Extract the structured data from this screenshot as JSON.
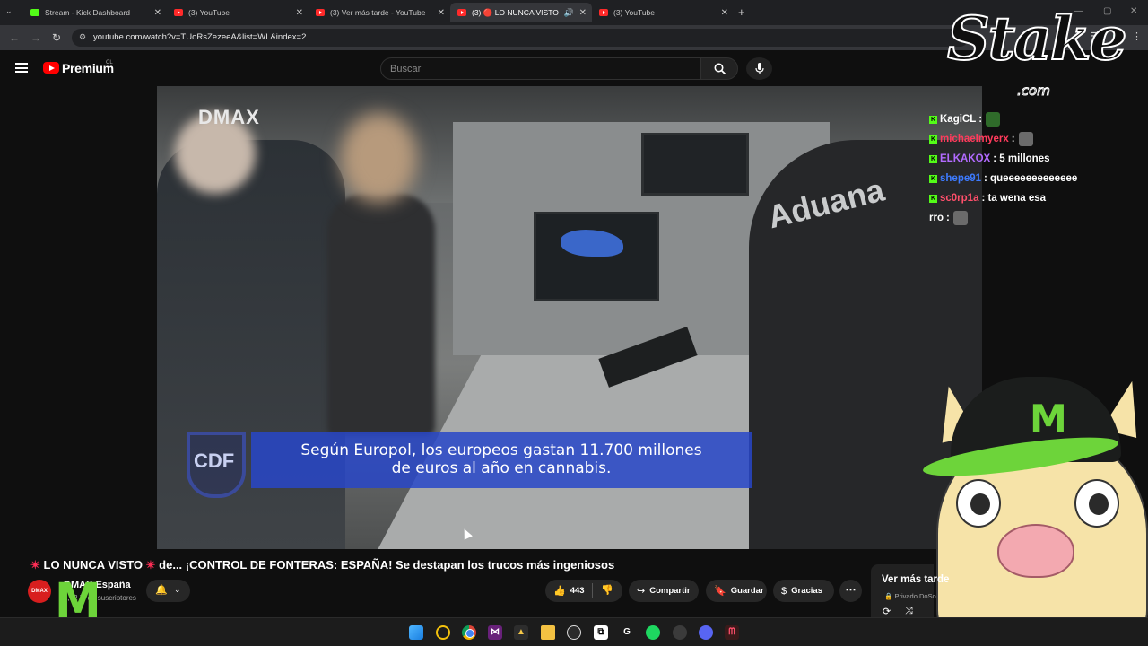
{
  "browser": {
    "tabs": [
      {
        "title": "Stream - Kick Dashboard",
        "icon": "kick-icon"
      },
      {
        "title": "(3) YouTube",
        "icon": "youtube-icon"
      },
      {
        "title": "(3) Ver más tarde - YouTube",
        "icon": "youtube-icon"
      },
      {
        "title": "(3) 🔴 LO NUNCA VISTO 🔴",
        "icon": "youtube-icon",
        "active": true
      },
      {
        "title": "(3) YouTube",
        "icon": "youtube-icon"
      }
    ],
    "url": "youtube.com/watch?v=TUoRsZezeeA&list=WL&index=2"
  },
  "youtube": {
    "brand": "Premium",
    "region": "CL",
    "search_placeholder": "Buscar"
  },
  "video": {
    "channel_watermark": "DMAX",
    "scene_text": "Aduana",
    "show_logo": "CDF",
    "subtitle_line1": "Según Europol, los europeos gastan 11.700 millones",
    "subtitle_line2": "de euros al año en cannabis.",
    "title_prefix": "✴",
    "title_main": " LO NUNCA VISTO ",
    "title_suffix_star": "✴",
    "title_rest": " de... ¡CONTROL DE FONTERAS: ESPAÑA! Se destapan los trucos más ingeniosos",
    "channel_avatar_text": "DMAX",
    "channel_name": "DMAX España",
    "subscribers": "1,32 M de suscriptores",
    "likes": "443",
    "share_label": "Compartir",
    "save_label": "Guardar",
    "thanks_label": "Gracias"
  },
  "playlist": {
    "title": "Ver más tarde",
    "privacy": "Privado",
    "owner": "DoSo"
  },
  "overlay": {
    "stake_word": "Stake",
    "stake_domain": ".com",
    "chat": [
      {
        "user": "KagiCL",
        "user_color": "#ffffff",
        "message": ":",
        "emote": true
      },
      {
        "user": "michaelmyerx",
        "user_color": "#ff3b5c",
        "message": ":",
        "emote": true
      },
      {
        "user": "ELKAKOX",
        "user_color": "#b26bff",
        "message": ": 5 millones",
        "emote": false
      },
      {
        "user": "shepe91",
        "user_color": "#3d7bff",
        "message": ": queeeeeeeeeeeee",
        "emote": false
      },
      {
        "user": "sc0rp1a",
        "user_color": "#ff4f6b",
        "message": ": ta wena esa",
        "emote": false
      },
      {
        "user": "rro",
        "user_color": "#ffffff",
        "message": ":",
        "emote": true
      }
    ],
    "cat_cap_logo": "M"
  },
  "taskbar": {
    "items": [
      "windows-start",
      "norton",
      "chrome",
      "visual-studio",
      "excel",
      "file-explorer",
      "obs",
      "capcut",
      "g-hub",
      "spotify",
      "steam",
      "discord",
      "app-red"
    ]
  },
  "colors": {
    "youtube_red": "#ff0000",
    "kick_green": "#53fc18",
    "monster_green": "#6dd43a",
    "subtitle_blue": "#2846c8"
  }
}
